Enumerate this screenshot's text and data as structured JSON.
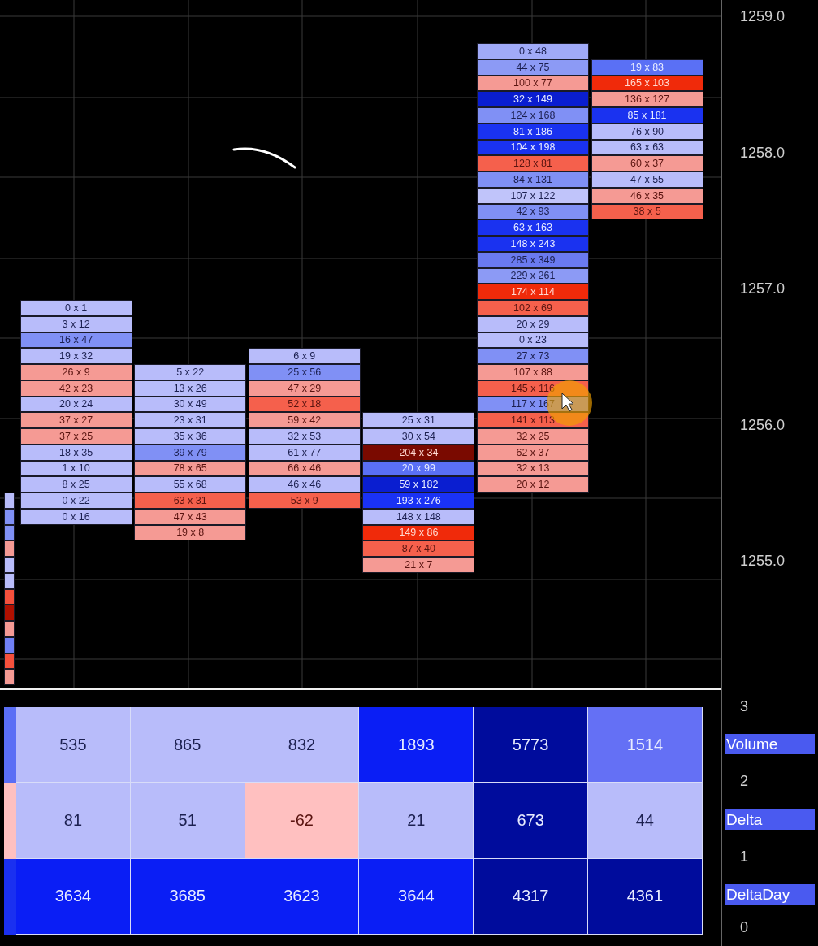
{
  "price_axis": {
    "labels": [
      "1259.0",
      "1258.0",
      "1257.0",
      "1256.0",
      "1255.0"
    ]
  },
  "footprint": {
    "edge_column": [
      {
        "color": "#b8bcfa"
      },
      {
        "color": "#8090f5"
      },
      {
        "color": "#8090f5"
      },
      {
        "color": "#f59a94"
      },
      {
        "color": "#b8bcfa"
      },
      {
        "color": "#b8bcfa"
      },
      {
        "color": "#f5503c"
      },
      {
        "color": "#b01000"
      },
      {
        "color": "#f59a94"
      },
      {
        "color": "#7080f5"
      },
      {
        "color": "#f5503c"
      },
      {
        "color": "#f59a94"
      }
    ],
    "columns": [
      {
        "cells": [
          {
            "text": "0 x 1",
            "color": "#b8bcfa"
          },
          {
            "text": "3 x 12",
            "color": "#b8bcfa"
          },
          {
            "text": "16 x 47",
            "color": "#8090f5"
          },
          {
            "text": "19 x 32",
            "color": "#b8bcfa"
          },
          {
            "text": "26 x 9",
            "color": "#f59a94"
          },
          {
            "text": "42 x 23",
            "color": "#f59a94"
          },
          {
            "text": "20 x 24",
            "color": "#b8bcfa"
          },
          {
            "text": "37 x 27",
            "color": "#f59a94"
          },
          {
            "text": "37 x 25",
            "color": "#f59a94"
          },
          {
            "text": "18 x 35",
            "color": "#b8bcfa"
          },
          {
            "text": "1 x 10",
            "color": "#b8bcfa"
          },
          {
            "text": "8 x 25",
            "color": "#b8bcfa"
          },
          {
            "text": "0 x 22",
            "color": "#b8bcfa"
          },
          {
            "text": "0 x 16",
            "color": "#b8bcfa"
          }
        ]
      },
      {
        "cells": [
          {
            "text": "5 x 22",
            "color": "#b8bcfa"
          },
          {
            "text": "13 x 26",
            "color": "#b8bcfa"
          },
          {
            "text": "30 x 49",
            "color": "#b8bcfa"
          },
          {
            "text": "23 x 31",
            "color": "#b8bcfa"
          },
          {
            "text": "35 x 36",
            "color": "#b8bcfa"
          },
          {
            "text": "39 x 79",
            "color": "#8090f5"
          },
          {
            "text": "78 x 65",
            "color": "#f59a94"
          },
          {
            "text": "55 x 68",
            "color": "#b8bcfa"
          },
          {
            "text": "63 x 31",
            "color": "#f5604c"
          },
          {
            "text": "47 x 43",
            "color": "#f59a94"
          },
          {
            "text": "19 x 8",
            "color": "#f59a94"
          }
        ]
      },
      {
        "cells": [
          {
            "text": "6 x 9",
            "color": "#b8bcfa"
          },
          {
            "text": "25 x 56",
            "color": "#8090f5"
          },
          {
            "text": "47 x 29",
            "color": "#f59a94"
          },
          {
            "text": "52 x 18",
            "color": "#f5604c"
          },
          {
            "text": "59 x 42",
            "color": "#f59a94"
          },
          {
            "text": "32 x 53",
            "color": "#b8bcfa"
          },
          {
            "text": "61 x 77",
            "color": "#b8bcfa"
          },
          {
            "text": "66 x 46",
            "color": "#f59a94"
          },
          {
            "text": "46 x 46",
            "color": "#b8bcfa"
          },
          {
            "text": "53 x 9",
            "color": "#f5604c"
          }
        ]
      },
      {
        "cells": [
          {
            "text": "25 x 31",
            "color": "#b8bcfa"
          },
          {
            "text": "30 x 54",
            "color": "#b8bcfa"
          },
          {
            "text": "204 x 34",
            "color": "#7a0a00"
          },
          {
            "text": "20 x 99",
            "color": "#5a70f5"
          },
          {
            "text": "59 x 182",
            "color": "#0a1ed0"
          },
          {
            "text": "193 x 276",
            "color": "#1a32f5"
          },
          {
            "text": "148 x 148",
            "color": "#b8bcfa"
          },
          {
            "text": "149 x 86",
            "color": "#f02a0a"
          },
          {
            "text": "87 x 40",
            "color": "#f5604c"
          },
          {
            "text": "21 x 7",
            "color": "#f59a94"
          }
        ]
      },
      {
        "cells": [
          {
            "text": "0 x 48",
            "color": "#a0aaf8"
          },
          {
            "text": "44 x 75",
            "color": "#8c9af5"
          },
          {
            "text": "100 x 77",
            "color": "#f59a94"
          },
          {
            "text": "32 x 149",
            "color": "#0a1ed0"
          },
          {
            "text": "124 x 168",
            "color": "#8090f5"
          },
          {
            "text": "81 x 186",
            "color": "#1a32f0"
          },
          {
            "text": "104 x 198",
            "color": "#1a32f0"
          },
          {
            "text": "128 x 81",
            "color": "#f5604c"
          },
          {
            "text": "84 x 131",
            "color": "#8090f5"
          },
          {
            "text": "107 x 122",
            "color": "#c0c4fa"
          },
          {
            "text": "42 x 93",
            "color": "#8090f5"
          },
          {
            "text": "63 x 163",
            "color": "#1a32f0"
          },
          {
            "text": "148 x 243",
            "color": "#1a32f0"
          },
          {
            "text": "285 x 349",
            "color": "#6a7af0"
          },
          {
            "text": "229 x 261",
            "color": "#8c9af5"
          },
          {
            "text": "174 x 114",
            "color": "#f02a0a"
          },
          {
            "text": "102 x 69",
            "color": "#f5604c"
          },
          {
            "text": "20 x 29",
            "color": "#b8bcfa"
          },
          {
            "text": "0 x 23",
            "color": "#b8bcfa"
          },
          {
            "text": "27 x 73",
            "color": "#8090f5"
          },
          {
            "text": "107 x 88",
            "color": "#f59a94"
          },
          {
            "text": "145 x 116",
            "color": "#f5604c"
          },
          {
            "text": "117 x 167",
            "color": "#8090f5"
          },
          {
            "text": "141 x 113",
            "color": "#f5604c"
          },
          {
            "text": "32 x 25",
            "color": "#f59a94"
          },
          {
            "text": "62 x 37",
            "color": "#f59a94"
          },
          {
            "text": "32 x 13",
            "color": "#f59a94"
          },
          {
            "text": "20 x 12",
            "color": "#f59a94"
          }
        ]
      },
      {
        "cells": [
          {
            "text": "19 x 83",
            "color": "#5a70f5"
          },
          {
            "text": "165 x 103",
            "color": "#f02a0a"
          },
          {
            "text": "136 x 127",
            "color": "#f59a94"
          },
          {
            "text": "85 x 181",
            "color": "#1a32f0"
          },
          {
            "text": "76 x 90",
            "color": "#b8bcfa"
          },
          {
            "text": "63 x 63",
            "color": "#b8bcfa"
          },
          {
            "text": "60 x 37",
            "color": "#f59a94"
          },
          {
            "text": "47 x 55",
            "color": "#b8bcfa"
          },
          {
            "text": "46 x 35",
            "color": "#f59a94"
          },
          {
            "text": "38 x 5",
            "color": "#f5604c"
          }
        ]
      }
    ]
  },
  "summary": {
    "scale_labels": [
      "3",
      "2",
      "1",
      "0"
    ],
    "rows": [
      {
        "label": "Volume",
        "stub": {
          "color": "#5a6ef5"
        },
        "cells": [
          {
            "text": "535",
            "color": "#b8bcfa"
          },
          {
            "text": "865",
            "color": "#b8bcfa"
          },
          {
            "text": "832",
            "color": "#b8bcfa"
          },
          {
            "text": "1893",
            "color": "#0a1ef5"
          },
          {
            "text": "5773",
            "color": "#000c9c"
          },
          {
            "text": "1514",
            "color": "#6470f5"
          }
        ]
      },
      {
        "label": "Delta",
        "stub": {
          "color": "#ffc0c0"
        },
        "cells": [
          {
            "text": "81",
            "color": "#b8bcfa"
          },
          {
            "text": "51",
            "color": "#b8bcfa"
          },
          {
            "text": "-62",
            "color": "#ffc0c0"
          },
          {
            "text": "21",
            "color": "#b8bcfa"
          },
          {
            "text": "673",
            "color": "#000c9c"
          },
          {
            "text": "44",
            "color": "#b8bcfa"
          }
        ]
      },
      {
        "label": "DeltaDay",
        "stub": {
          "color": "#1a30f0"
        },
        "cells": [
          {
            "text": "3634",
            "color": "#0a1ef5"
          },
          {
            "text": "3685",
            "color": "#0a1ef5"
          },
          {
            "text": "3623",
            "color": "#0a1ef5"
          },
          {
            "text": "3644",
            "color": "#0a1ef5"
          },
          {
            "text": "4317",
            "color": "#000c9c"
          },
          {
            "text": "4361",
            "color": "#000c9c"
          }
        ]
      }
    ]
  }
}
